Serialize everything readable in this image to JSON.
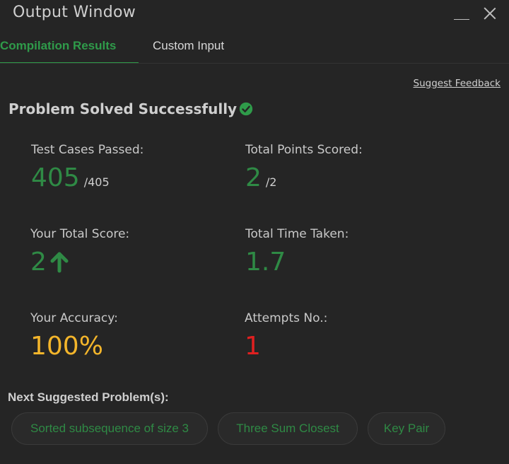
{
  "window": {
    "title": "Output Window",
    "controls": [
      "minimize-icon",
      "close-icon"
    ]
  },
  "tabs": [
    {
      "label": "Compilation Results",
      "active": true
    },
    {
      "label": "Custom Input",
      "active": false
    }
  ],
  "feedback_link": "Suggest Feedback",
  "status": {
    "text": "Problem Solved Successfully",
    "icon": "check-circle-icon"
  },
  "stats": {
    "test_cases": {
      "label": "Test Cases Passed:",
      "value": "405",
      "total": "/405"
    },
    "points": {
      "label": "Total Points Scored:",
      "value": "2",
      "total": "/2"
    },
    "score": {
      "label": "Your Total Score:",
      "value": "2",
      "icon": "arrow-up-icon"
    },
    "time": {
      "label": "Total Time Taken:",
      "value": "1.7"
    },
    "accuracy": {
      "label": "Your Accuracy:",
      "value": "100%"
    },
    "attempts": {
      "label": "Attempts No.:",
      "value": "1"
    }
  },
  "next": {
    "title": "Next Suggested Problem(s):",
    "problems": [
      "Sorted subsequence of size 3",
      "Three Sum Closest",
      "Key Pair"
    ]
  },
  "colors": {
    "background": "#252525",
    "accent_green": "#2f9b4a",
    "value_green": "#2f8a45",
    "accuracy_yellow": "#f3b52b",
    "attempts_red": "#e02020"
  }
}
